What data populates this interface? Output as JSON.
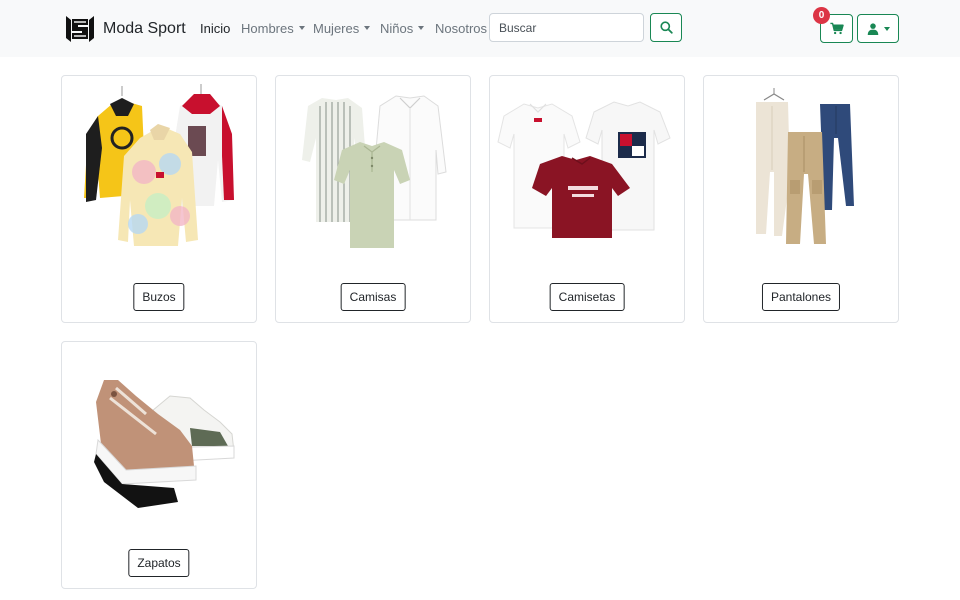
{
  "brand": {
    "name": "Moda Sport",
    "logo_icon": "ms-logo-icon"
  },
  "nav": {
    "items": [
      {
        "label": "Inicio",
        "active": true,
        "dropdown": false
      },
      {
        "label": "Hombres",
        "active": false,
        "dropdown": true
      },
      {
        "label": "Mujeres",
        "active": false,
        "dropdown": true
      },
      {
        "label": "Niños",
        "active": false,
        "dropdown": true
      },
      {
        "label": "Nosotros",
        "active": false,
        "dropdown": false
      }
    ]
  },
  "search": {
    "placeholder": "Buscar",
    "value": "",
    "button_icon": "search-icon"
  },
  "cart": {
    "count": "0",
    "icon": "cart-icon"
  },
  "user_menu": {
    "icon": "user-icon"
  },
  "categories": [
    {
      "label": "Buzos",
      "image": "hoodies"
    },
    {
      "label": "Camisas",
      "image": "shirts"
    },
    {
      "label": "Camisetas",
      "image": "t-shirts"
    },
    {
      "label": "Pantalones",
      "image": "pants"
    },
    {
      "label": "Zapatos",
      "image": "shoes"
    }
  ],
  "colors": {
    "accent": "#198754",
    "badge": "#dc3545",
    "navbar_bg": "#f8f9fa"
  }
}
